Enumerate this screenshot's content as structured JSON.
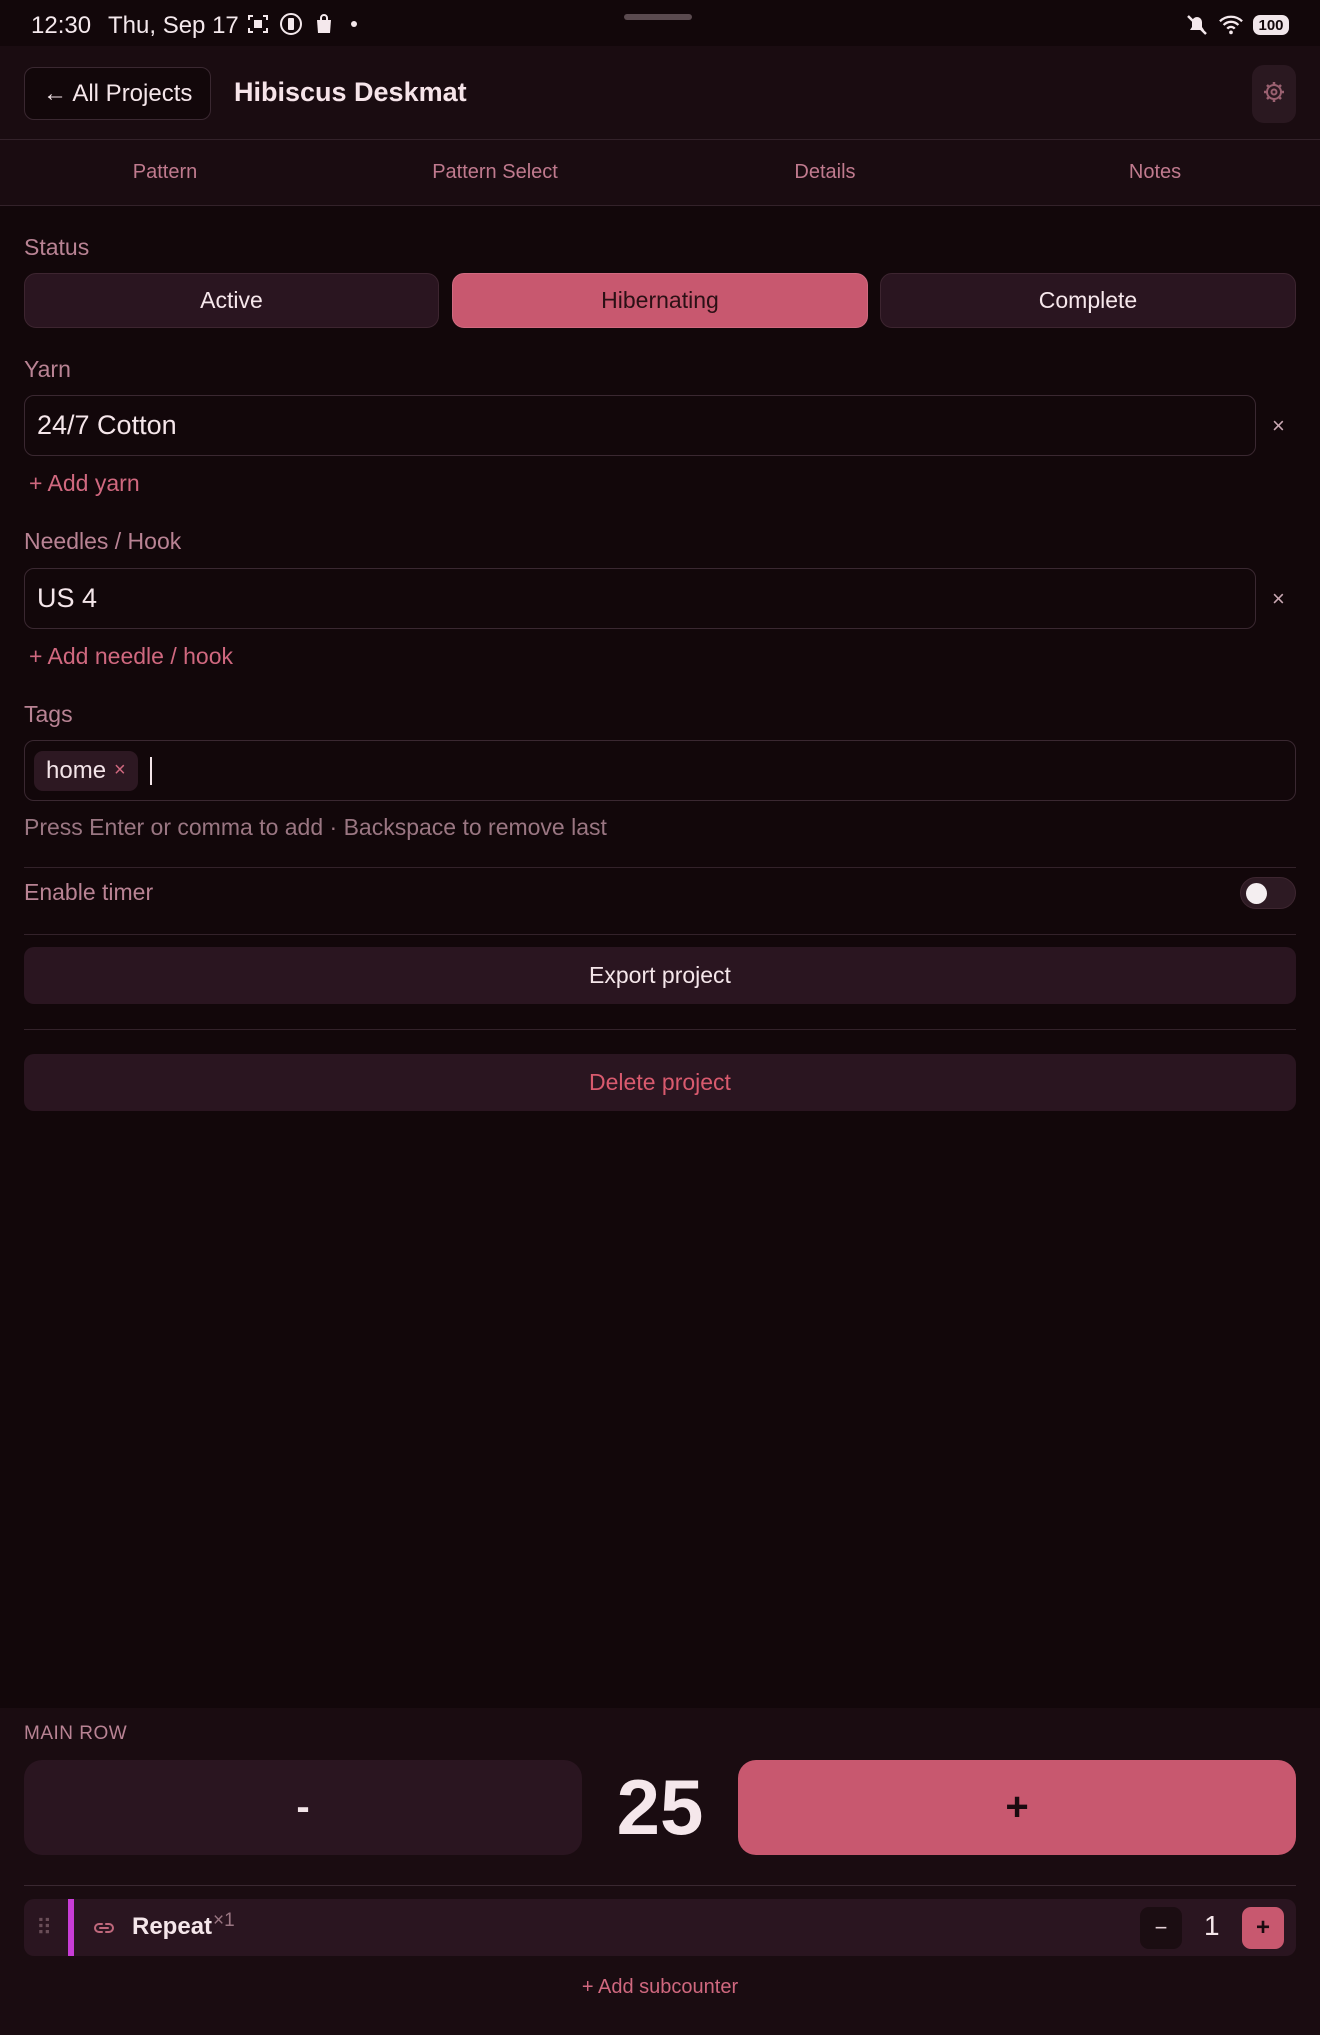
{
  "status_bar": {
    "time": "12:30",
    "date": "Thu, Sep 17",
    "battery": "100",
    "left_icons": [
      "screenshot-icon",
      "vibrate-icon",
      "shopping-bag-icon"
    ],
    "right_icons": [
      "mute-icon",
      "wifi-icon"
    ]
  },
  "header": {
    "back_label": "← All Projects",
    "title": "Hibiscus Deskmat",
    "settings_icon": "gear-icon"
  },
  "tabs": [
    {
      "label": "Pattern"
    },
    {
      "label": "Pattern Select"
    },
    {
      "label": "Details"
    },
    {
      "label": "Notes"
    }
  ],
  "status": {
    "label": "Status",
    "options": [
      {
        "label": "Active",
        "selected": false
      },
      {
        "label": "Hibernating",
        "selected": true
      },
      {
        "label": "Complete",
        "selected": false
      }
    ]
  },
  "yarn": {
    "label": "Yarn",
    "value": "24/7 Cotton",
    "clear": "×",
    "add_label": "+ Add yarn"
  },
  "needles": {
    "label": "Needles / Hook",
    "value": "US 4",
    "clear": "×",
    "add_label": "+ Add needle / hook"
  },
  "tags": {
    "label": "Tags",
    "items": [
      {
        "label": "home",
        "remove": "×"
      }
    ],
    "hint": "Press Enter or comma to add · Backspace to remove last"
  },
  "timer": {
    "label": "Enable timer",
    "enabled": false
  },
  "actions": {
    "export_label": "Export project",
    "delete_label": "Delete project"
  },
  "counter": {
    "section_label": "MAIN ROW",
    "minus_label": "-",
    "value": "25",
    "plus_label": "+"
  },
  "subcounter": {
    "name": "Repeat",
    "multiplier": "×1",
    "minus_label": "−",
    "value": "1",
    "plus_label": "+",
    "color": "#c83cd6",
    "add_label": "+ Add subcounter"
  },
  "colors": {
    "accent": "#c8586f",
    "background": "#12070a",
    "danger_text": "#d85a6e"
  }
}
